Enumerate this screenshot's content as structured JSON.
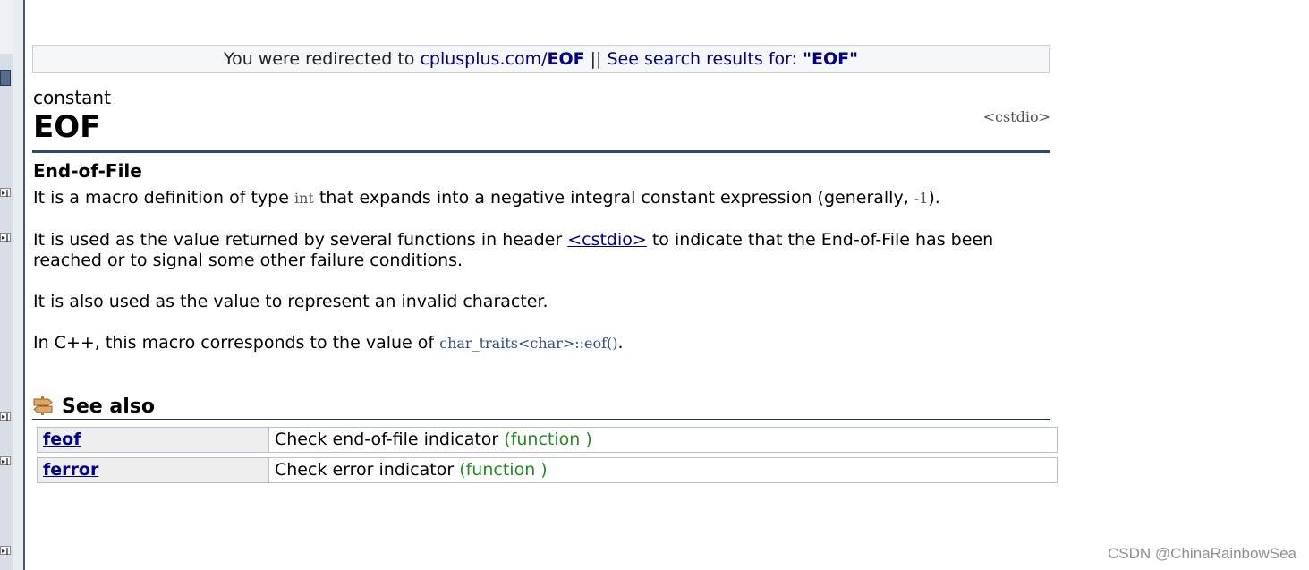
{
  "redirect": {
    "prefix": "You were redirected to ",
    "site": "cplusplus.com/",
    "target": "EOF",
    "separator": " || ",
    "search_prefix": "See search results for: ",
    "search_term": "\"EOF\""
  },
  "entry": {
    "kind": "constant",
    "name": "EOF",
    "header": "<cstdio>",
    "subtitle": "End-of-File"
  },
  "paragraphs": {
    "p1_a": "It is a macro definition of type ",
    "p1_code": "int",
    "p1_b": " that expands into a negative integral constant expression (generally, ",
    "p1_code2": "-1",
    "p1_c": ").",
    "p2_a": "It is used as the value returned by several functions in header ",
    "p2_link": "<cstdio>",
    "p2_b": " to indicate that the End-of-File has been reached or to signal some other failure conditions.",
    "p3": "It is also used as the value to represent an invalid character.",
    "p4_a": "In C++, this macro corresponds to the value of ",
    "p4_code": "char_traits<char>::eof()",
    "p4_b": "."
  },
  "see_also": {
    "title": "See also",
    "rows": [
      {
        "name": "feof",
        "desc": "Check end-of-file indicator ",
        "kind": "(function )"
      },
      {
        "name": "ferror",
        "desc": "Check error indicator ",
        "kind": "(function )"
      }
    ]
  },
  "watermark": "CSDN @ChinaRainbowSea",
  "colors": {
    "link": "#000080",
    "rule": "#2b4677",
    "function_kind": "#228b22"
  }
}
